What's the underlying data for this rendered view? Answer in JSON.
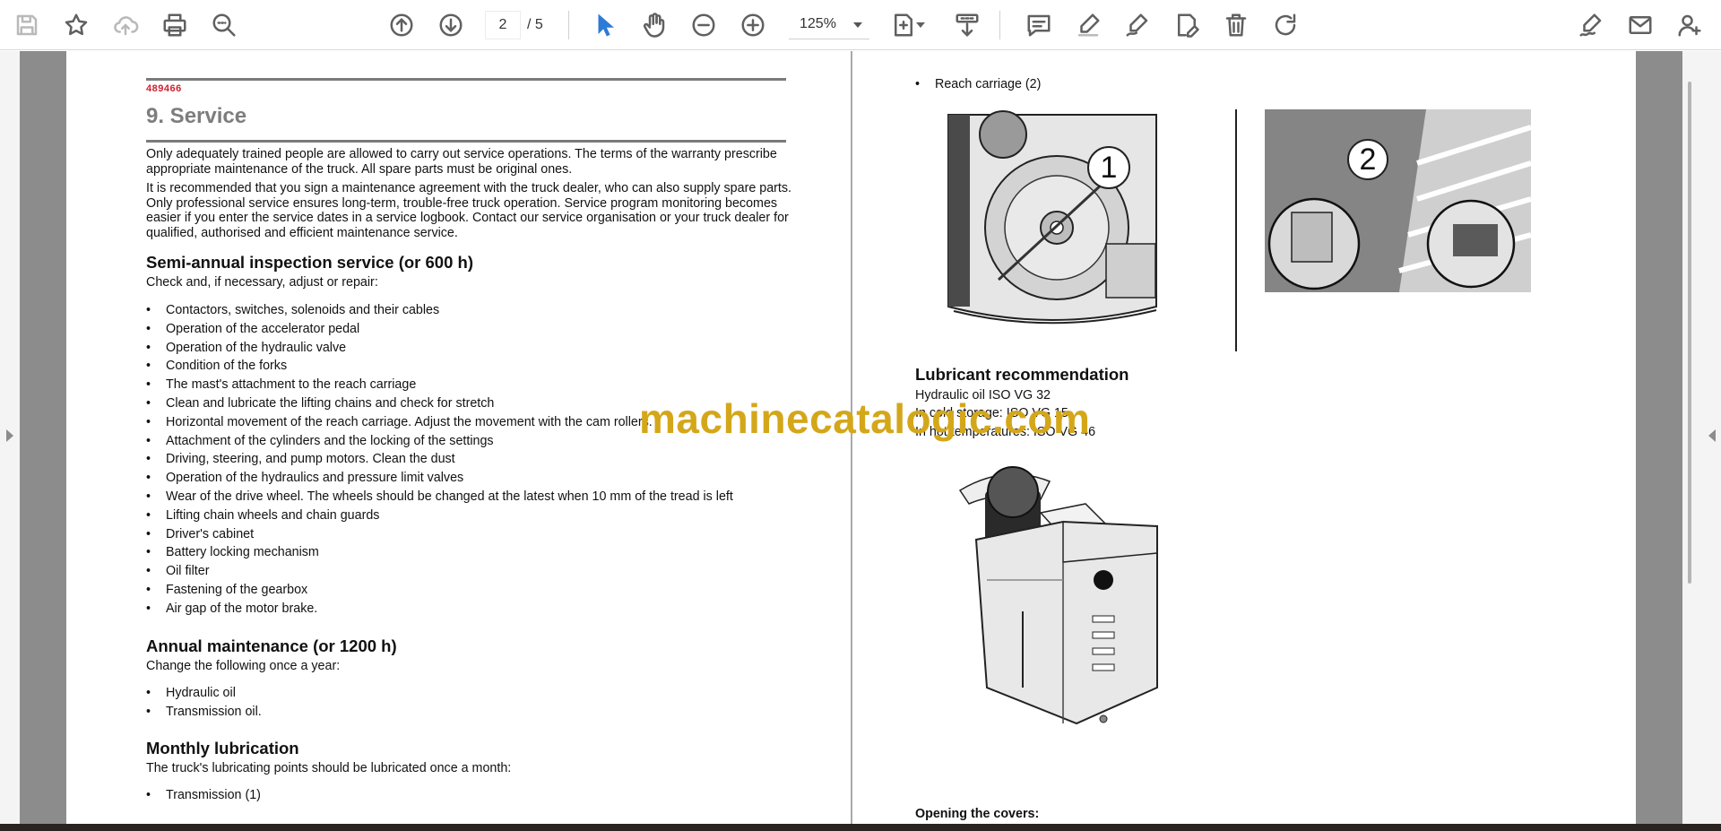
{
  "toolbar": {
    "current_page": "2",
    "total_pages": "/ 5",
    "zoom": "125%"
  },
  "left_page": {
    "doc_number": "489466",
    "title": "9. Service",
    "intro_1": "Only adequately trained people are allowed to carry out service operations. The terms of the warranty prescribe appropriate maintenance of the truck. All spare parts must be original ones.",
    "intro_2": "It is recommended that you sign a maintenance agreement with the truck dealer, who can also supply spare parts. Only professional service ensures long-term, trouble-free truck operation. Service program monitoring becomes easier if you enter the service dates in a service logbook. Contact our service organisation or your truck dealer for qualified, authorised and efficient maintenance service.",
    "semi_annual": {
      "heading": "Semi-annual inspection service (or 600 h)",
      "lead": "Check and, if necessary, adjust or repair:",
      "items": [
        "Contactors, switches, solenoids and their cables",
        "Operation of the accelerator pedal",
        "Operation of the hydraulic valve",
        "Condition of the forks",
        "The mast's attachment to the reach carriage",
        "Clean and lubricate the lifting chains and check for stretch",
        "Horizontal movement of the reach carriage. Adjust the movement with the cam rollers.",
        "Attachment of the cylinders and the locking of the settings",
        "Driving, steering, and pump motors. Clean the dust",
        "Operation of the hydraulics and pressure limit valves",
        "Wear of the drive wheel. The wheels should be changed at the latest when 10 mm of the tread is left",
        "Lifting chain wheels and chain guards",
        "Driver's cabinet",
        "Battery locking mechanism",
        "Oil filter",
        "Fastening of the gearbox",
        "Air gap of the motor brake."
      ]
    },
    "annual": {
      "heading": "Annual maintenance (or 1200 h)",
      "lead": "Change the following once a year:",
      "items": [
        "Hydraulic oil",
        "Transmission oil."
      ]
    },
    "monthly": {
      "heading": "Monthly lubrication",
      "lead": "The truck's lubricating points should be lubricated once a month:",
      "items": [
        "Transmission (1)"
      ]
    }
  },
  "right_page": {
    "items": [
      "Reach carriage (2)"
    ],
    "figure_1_label": "1",
    "figure_2_label": "2",
    "lubricant": {
      "heading": "Lubricant recommendation",
      "line_1": "Hydraulic oil ISO VG 32",
      "line_2": "In cold storage: ISO VG 15",
      "line_3": "In hot temperatures: ISO VG 46"
    },
    "opening_covers": "Opening the covers:"
  },
  "watermark": "machinecatalogic.com"
}
